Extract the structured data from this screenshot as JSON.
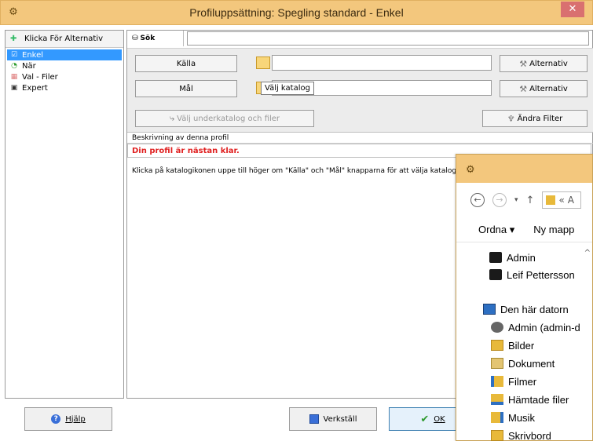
{
  "window": {
    "title": "Profiluppsättning: Spegling standard - Enkel",
    "close_label": "✕"
  },
  "left": {
    "header": "Klicka För Alternativ",
    "items": [
      {
        "label": "Enkel",
        "selected": true,
        "icon": "checklist-icon"
      },
      {
        "label": "När",
        "selected": false,
        "icon": "clock-icon"
      },
      {
        "label": "Val - Filer",
        "selected": false,
        "icon": "grid-icon"
      },
      {
        "label": "Expert",
        "selected": false,
        "icon": "gear-icon"
      }
    ],
    "help_label": "Hjälp"
  },
  "search": {
    "tab_label": "Sök",
    "value": ""
  },
  "config": {
    "source_label": "Källa",
    "dest_label": "Mål",
    "source_path": "",
    "dest_path": "",
    "tooltip": "Välj katalog",
    "alt_label": "Alternativ",
    "alt_label_2": "Alternativ",
    "subdir_label": "Välj underkatalog och filer",
    "filter_label": "Ändra Filter"
  },
  "description": {
    "header": "Beskrivning av denna profil",
    "warning": "Din profil är nästan klar.",
    "text": "Klicka på katalogikonen uppe till höger om \"Källa\" och \"Mål\" knapparna för att välja katalog"
  },
  "footer": {
    "apply_label": "Verkställ",
    "ok_label": "OK"
  },
  "explorer": {
    "address_prefix": "«",
    "address_text": "A",
    "organize_label": "Ordna ▾",
    "new_folder_label": "Ny mapp",
    "tree": [
      {
        "label": "Admin",
        "icon": "user-icon"
      },
      {
        "label": "Leif Pettersson",
        "icon": "user-icon"
      },
      {
        "label": "Den här datorn",
        "icon": "computer-icon"
      },
      {
        "label": "Admin (admin-d",
        "icon": "network-user-icon"
      },
      {
        "label": "Bilder",
        "icon": "pictures-folder-icon"
      },
      {
        "label": "Dokument",
        "icon": "documents-folder-icon"
      },
      {
        "label": "Filmer",
        "icon": "videos-folder-icon"
      },
      {
        "label": "Hämtade filer",
        "icon": "downloads-folder-icon"
      },
      {
        "label": "Musik",
        "icon": "music-folder-icon"
      },
      {
        "label": "Skrivbord",
        "icon": "desktop-folder-icon"
      }
    ]
  },
  "colors": {
    "titlebar": "#f3c77d",
    "selection": "#3399ff",
    "warning": "#e02020"
  }
}
